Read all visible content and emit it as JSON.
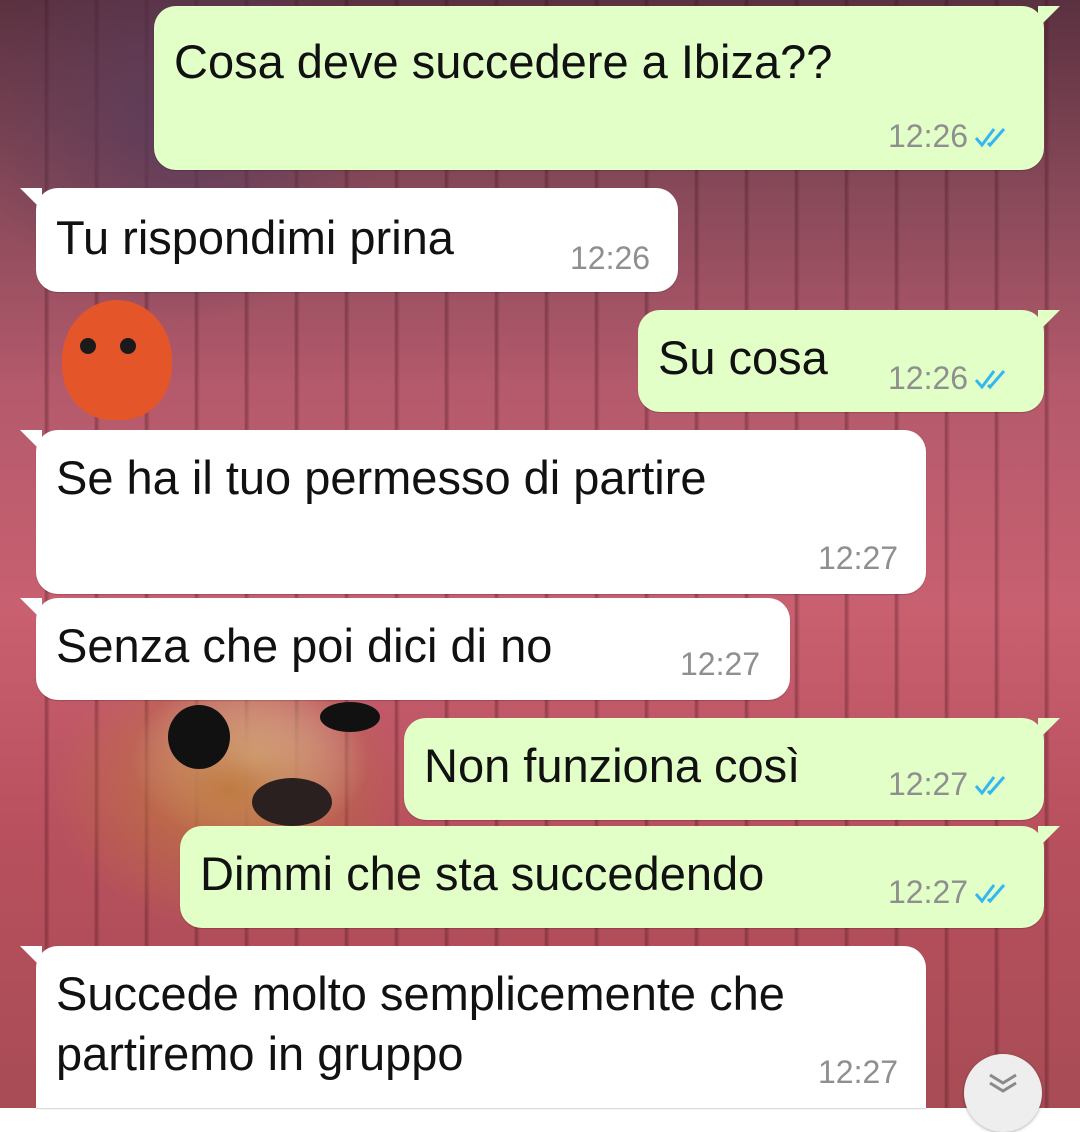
{
  "messages": [
    {
      "direction": "out",
      "text": "Cosa deve succedere a Ibiza??",
      "time": "12:26",
      "status": "read"
    },
    {
      "direction": "in",
      "text": "Tu rispondimi prina",
      "time": "12:26"
    },
    {
      "direction": "out",
      "text": "Su cosa",
      "time": "12:26",
      "status": "read"
    },
    {
      "direction": "in",
      "text": "Se ha il tuo permesso di partire",
      "time": "12:27"
    },
    {
      "direction": "in",
      "text": "Senza che poi dici di no",
      "time": "12:27"
    },
    {
      "direction": "out",
      "text": "Non funziona così",
      "time": "12:27",
      "status": "read"
    },
    {
      "direction": "out",
      "text": "Dimmi che sta succedendo",
      "time": "12:27",
      "status": "read"
    },
    {
      "direction": "in",
      "text": "Succede molto semplicemente che\npartiremo in gruppo",
      "time": "12:27"
    }
  ],
  "colors": {
    "outgoing_bubble": "#e2ffc7",
    "incoming_bubble": "#ffffff",
    "read_ticks": "#34b7f1",
    "timestamp": "#8f8f8f"
  },
  "icons": {
    "read_receipt": "double-check-icon",
    "scroll_down": "chevron-double-down-icon"
  }
}
